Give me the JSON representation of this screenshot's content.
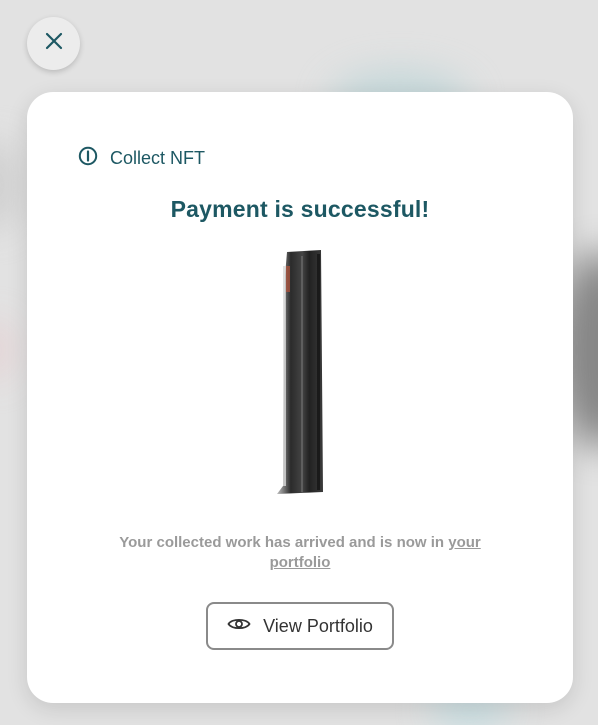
{
  "dialog": {
    "close_icon": "close-icon",
    "header_icon": "info-circle-icon",
    "header_label": "Collect NFT",
    "title": "Payment is successful!",
    "message_prefix": "Your collected work has arrived and is now in ",
    "message_link": "your portfolio",
    "view_button_icon": "eye-icon",
    "view_button_label": "View Portfolio"
  },
  "colors": {
    "accent": "#1d5863",
    "muted_text": "#9a9a9a",
    "button_border": "#8a8a8a",
    "backdrop": "#e2e2e2"
  }
}
